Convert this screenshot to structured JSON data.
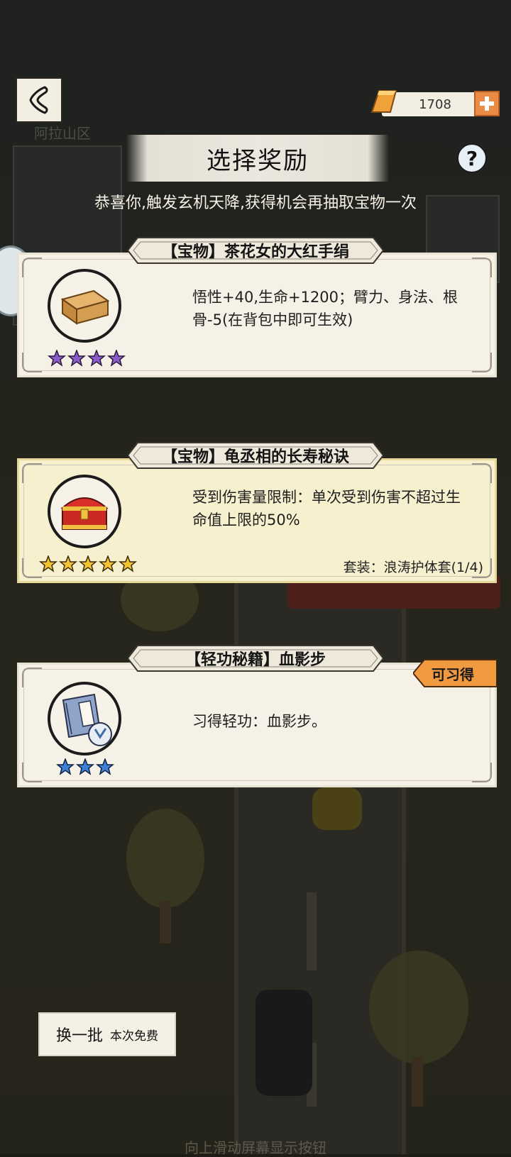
{
  "header": {
    "title": "选择奖励",
    "subtitle": "恭喜你,触发玄机天降,获得机会再抽取宝物一次",
    "currency_amount": "1708",
    "help_label": "?",
    "background_sign": "阿拉山区"
  },
  "cards": [
    {
      "name": "【宝物】茶花女的大红手绢",
      "icon": "wooden-box-icon",
      "stars": 4,
      "star_color": "#8a5cc9",
      "description": "悟性+40,生命+1200；臂力、身法、根骨-5(在背包中即可生效)",
      "set_info": "",
      "tag": ""
    },
    {
      "name": "【宝物】龟丞相的长寿秘诀",
      "icon": "treasure-chest-icon",
      "stars": 5,
      "star_color": "#f2c230",
      "description": "受到伤害量限制：单次受到伤害不超过生命值上限的50%",
      "set_info": "套装：浪涛护体套(1/4)",
      "tag": ""
    },
    {
      "name": "【轻功秘籍】血影步",
      "icon": "book-icon",
      "stars": 3,
      "star_color": "#3f7fd6",
      "description": "习得轻功：血影步。",
      "set_info": "",
      "tag": "可习得"
    }
  ],
  "footer": {
    "refresh_label": "换一批",
    "refresh_cost": "本次免费",
    "hint": "向上滑动屏幕显示按钮"
  },
  "colors": {
    "accent_orange": "#f29a3f",
    "card_bg": "#f5f1e6",
    "card_gold_bg": "#f7f0cf"
  }
}
